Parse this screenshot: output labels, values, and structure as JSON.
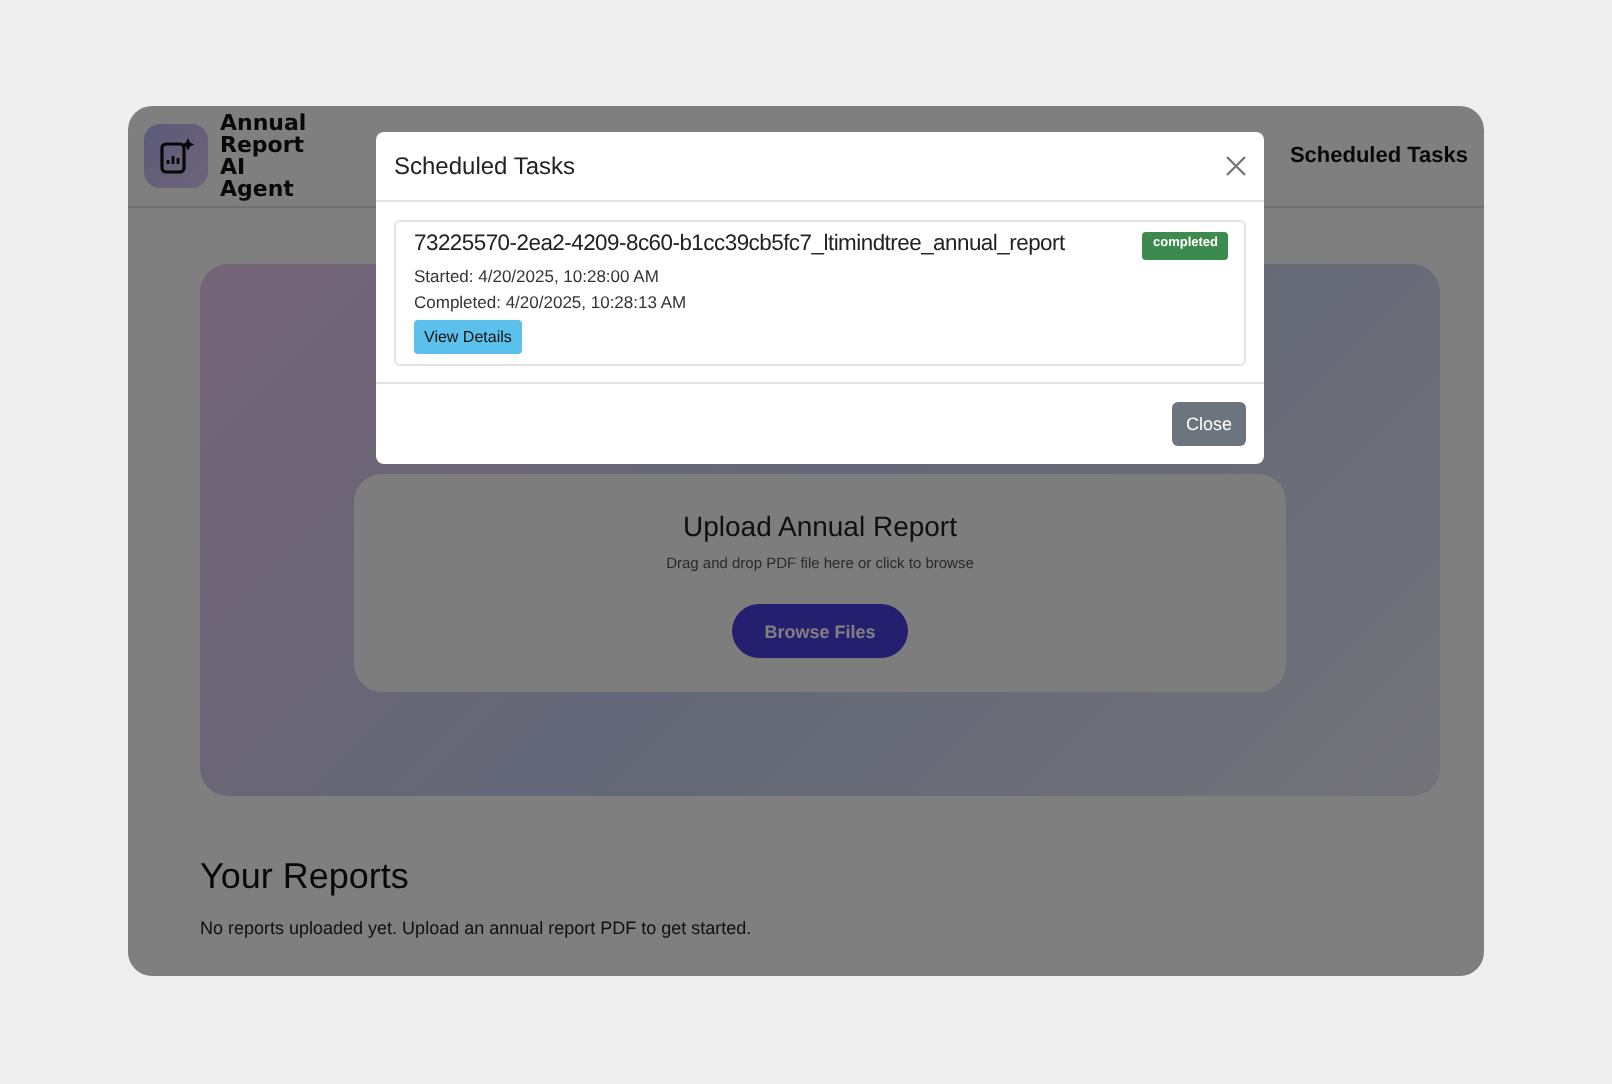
{
  "app": {
    "logo_text": "Annual Report AI Agent",
    "nav": [
      "Scheduled Tasks"
    ]
  },
  "upload": {
    "title": "Upload Annual Report",
    "hint": "Drag and drop PDF file here or click to browse",
    "button": "Browse Files"
  },
  "reports": {
    "title": "Your Reports",
    "empty_text": "No reports uploaded yet. Upload an annual report PDF to get started."
  },
  "modal": {
    "title": "Scheduled Tasks",
    "tasks": [
      {
        "name": "73225570-2ea2-4209-8c60-b1cc39cb5fc7_ltimindtree_annual_report",
        "status": "completed",
        "started": "Started: 4/20/2025, 10:28:00 AM",
        "completed": "Completed: 4/20/2025, 10:28:13 AM",
        "button": "View Details"
      }
    ],
    "close_button": "Close"
  }
}
